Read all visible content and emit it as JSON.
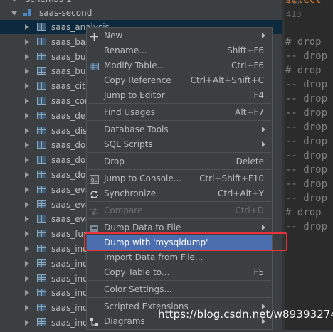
{
  "tree": {
    "top_row_label": "schemas 1",
    "database_label": "saas-second",
    "tables": [
      "saas_analysis",
      "saas_bas",
      "saas_bu",
      "saas_bu",
      "saas_citi",
      "saas_con",
      "saas_dec",
      "saas_dis",
      "saas_do",
      "saas_do",
      "saas_do",
      "saas_eva",
      "saas_eva",
      "saas_eva",
      "saas_fun",
      "saas_ind",
      "saas_ind",
      "saas_ind",
      "saas_ind",
      "saas_ind",
      "saas_ind"
    ]
  },
  "editor": {
    "line_numbers": [
      "412",
      "413"
    ],
    "keyword_fragment": "select",
    "lines": [
      "# drop",
      "-- drop",
      "# drop",
      "-- drop",
      "-- drop",
      "-- drop",
      "-- drop",
      "-- drop",
      "-- drop",
      "-- drop",
      "-- drop",
      "-- drop",
      "# drop",
      "-- drop"
    ]
  },
  "menu": {
    "items": [
      {
        "label": "New",
        "shortcut": "",
        "submenu": true
      },
      {
        "label": "Rename...",
        "shortcut": "Shift+F6"
      },
      {
        "label": "Modify Table...",
        "shortcut": "Ctrl+F6"
      },
      {
        "label": "Copy Reference",
        "shortcut": "Ctrl+Alt+Shift+C"
      },
      {
        "label": "Jump to Editor",
        "shortcut": "F4"
      },
      {
        "label": "Find Usages",
        "shortcut": "Alt+F7"
      },
      {
        "label": "Database Tools",
        "shortcut": "",
        "submenu": true
      },
      {
        "label": "SQL Scripts",
        "shortcut": "",
        "submenu": true
      },
      {
        "label": "Drop",
        "shortcut": "Delete"
      },
      {
        "label": "Jump to Console...",
        "shortcut": "Ctrl+Shift+F10"
      },
      {
        "label": "Synchronize",
        "shortcut": "Ctrl+Alt+Y"
      },
      {
        "label": "Compare",
        "shortcut": "Ctrl+D",
        "disabled": true
      },
      {
        "label": "Dump Data to File",
        "shortcut": "",
        "submenu": true
      },
      {
        "label": "Dump with 'mysqldump'",
        "shortcut": "",
        "highlighted": true
      },
      {
        "label": "Import Data from File...",
        "shortcut": ""
      },
      {
        "label": "Copy Table to...",
        "shortcut": "F5"
      },
      {
        "label": "Color Settings...",
        "shortcut": ""
      },
      {
        "label": "Scripted Extensions",
        "shortcut": "",
        "submenu": true
      },
      {
        "label": "Diagrams",
        "shortcut": "",
        "submenu": true
      }
    ]
  },
  "watermark": "https://blog.csdn.net/w893932747",
  "colors": {
    "panel_bg": "#3c3f41",
    "editor_bg": "#2b2b2b",
    "highlight": "#4b6eaf",
    "selection_row": "#0d293e",
    "annotation_red": "#e8323b",
    "keyword_orange": "#cc7832"
  }
}
